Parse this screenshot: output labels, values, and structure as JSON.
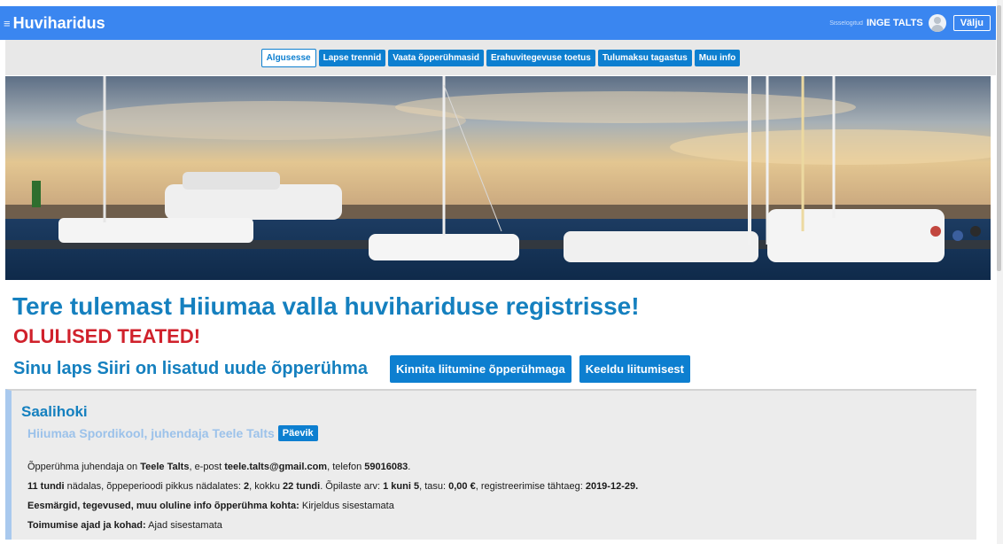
{
  "header": {
    "title": "Huviharidus",
    "user_hint": "Sisselogitud",
    "user_name": "INGE TALTS",
    "logout_label": "Välju",
    "menu_icon": "hamburger-icon"
  },
  "nav": {
    "items": [
      {
        "label": "Algusesse",
        "active": true
      },
      {
        "label": "Lapse trennid"
      },
      {
        "label": "Vaata õpperühmasid"
      },
      {
        "label": "Erahuvitegevuse toetus"
      },
      {
        "label": "Tulumaksu tagastus"
      },
      {
        "label": "Muu info"
      }
    ]
  },
  "hero": {
    "subject": "harbor-with-sailboats-at-sunset"
  },
  "main": {
    "welcome": "Tere tulemast Hiiumaa valla huvihariduse registrisse!",
    "important": "OLULISED TEATED!",
    "invite_text": "Sinu laps Siiri on lisatud uude õpperühma",
    "confirm_label": "Kinnita liitumine õpperühmaga",
    "decline_label": "Keeldu liitumisest"
  },
  "group": {
    "title": "Saalihoki",
    "school": "Hiiumaa Spordikool, juhendaja Teele Talts",
    "diary_label": "Päevik",
    "l1_a": "Õpperühma juhendaja on ",
    "l1_name": "Teele Talts",
    "l1_b": ", e-post ",
    "l1_email": "teele.talts@gmail.com",
    "l1_c": ", telefon ",
    "l1_phone": "59016083",
    "l1_d": ".",
    "l2_hours": "11 tundi",
    "l2_a": " nädalas, õppeperioodi pikkus nädalates: ",
    "l2_weeks": "2",
    "l2_b": ", kokku ",
    "l2_total": "22 tundi",
    "l2_c": ". Õpilaste arv: ",
    "l2_students": "1 kuni 5",
    "l2_d": ", tasu: ",
    "l2_fee": "0,00 €",
    "l2_e": ", registreerimise tähtaeg: ",
    "l2_deadline": "2019-12-29.",
    "l3_label": "Eesmärgid, tegevused, muu oluline info õpperühma kohta:",
    "l3_value": " Kirjeldus sisestamata",
    "l4_label": "Toimumise ajad ja kohad:",
    "l4_value": " Ajad sisestamata"
  },
  "colors": {
    "header_bg": "#3a86f0",
    "primary_button": "#0d7fd0",
    "heading_blue": "#1580bf",
    "alert_red": "#d0212b"
  }
}
